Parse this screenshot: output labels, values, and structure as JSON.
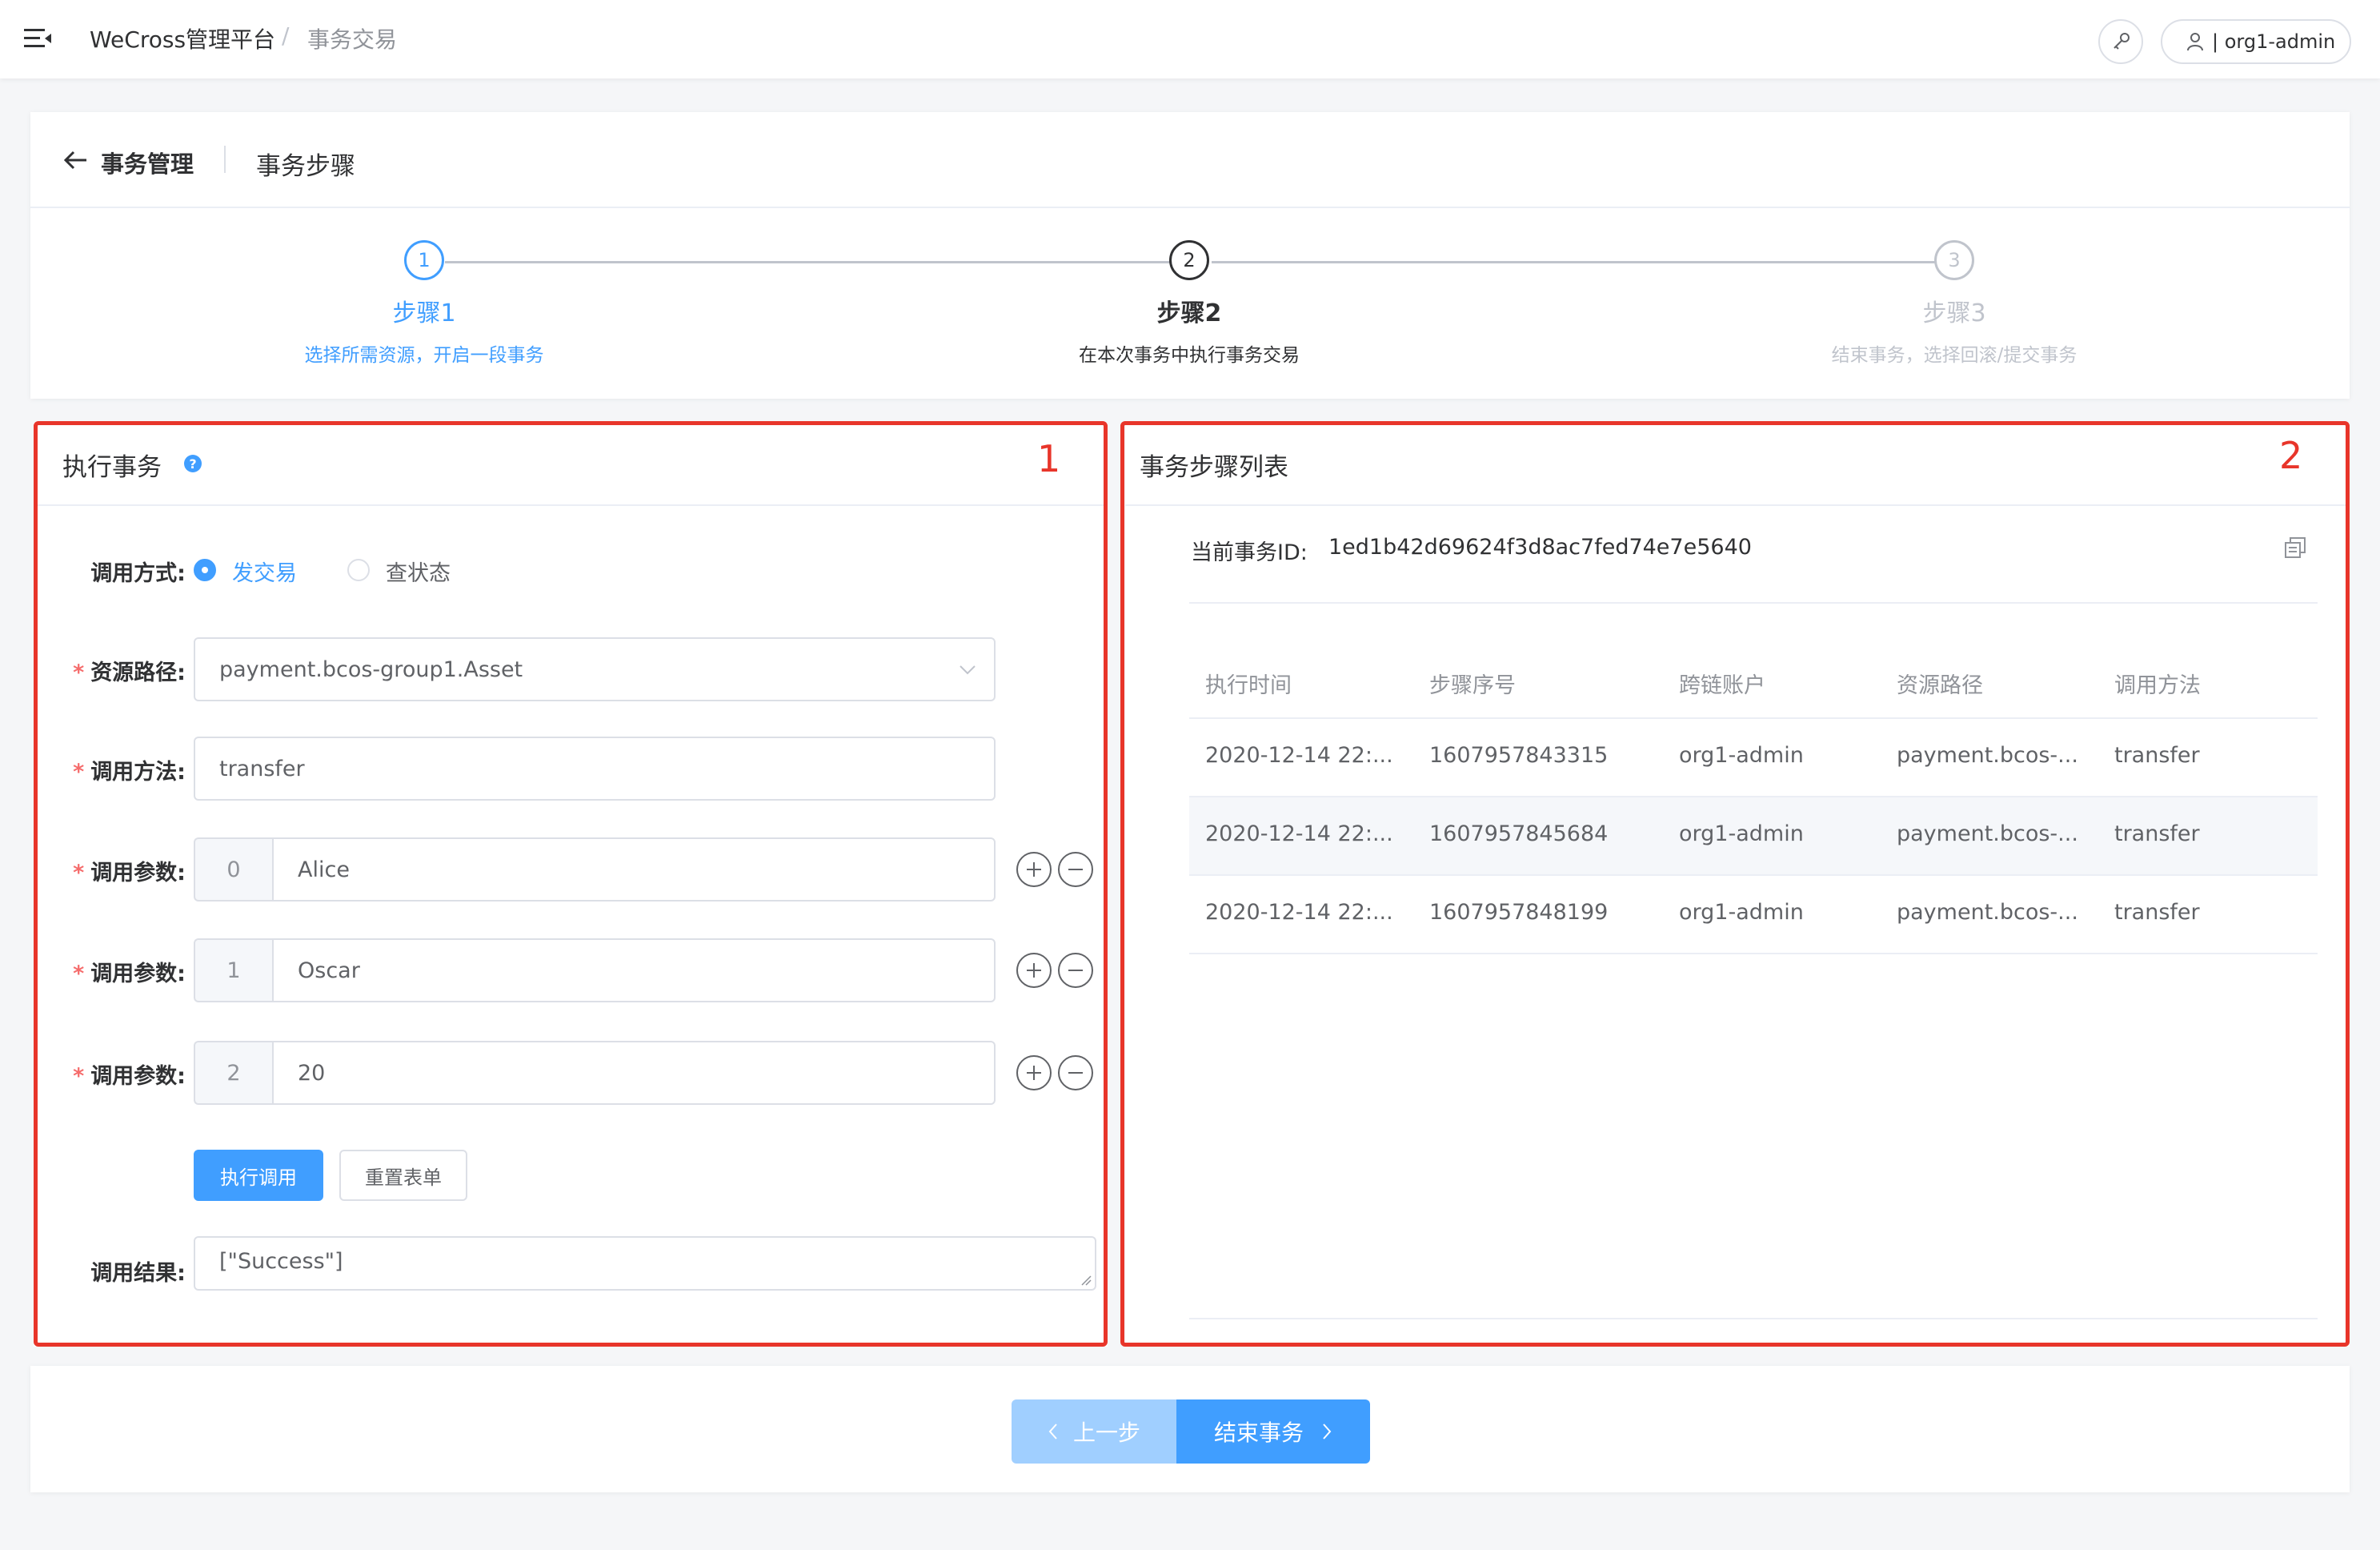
{
  "topbar": {
    "brand": "WeCross管理平台",
    "separator": "/",
    "breadcrumb": "事务交易",
    "user_label": "| org1-admin"
  },
  "header": {
    "back_label": "事务管理",
    "title": "事务步骤"
  },
  "steps": [
    {
      "number": "1",
      "title": "步骤1",
      "desc": "选择所需资源，开启一段事务",
      "status": "done"
    },
    {
      "number": "2",
      "title": "步骤2",
      "desc": "在本次事务中执行事务交易",
      "status": "current"
    },
    {
      "number": "3",
      "title": "步骤3",
      "desc": "结束事务，选择回滚/提交事务",
      "status": "wait"
    }
  ],
  "exec_panel": {
    "title": "执行事务",
    "help_glyph": "?",
    "box_number": "1",
    "invoke_mode_label": "调用方式:",
    "mode_send": "发交易",
    "mode_query": "查状态",
    "resource_label": "资源路径:",
    "resource_value": "payment.bcos-group1.Asset",
    "method_label": "调用方法:",
    "method_value": "transfer",
    "param_label": "调用参数:",
    "params": [
      {
        "index": "0",
        "value": "Alice"
      },
      {
        "index": "1",
        "value": "Oscar"
      },
      {
        "index": "2",
        "value": "20"
      }
    ],
    "required_mark": "*",
    "execute_button": "执行调用",
    "reset_button": "重置表单",
    "result_label": "调用结果:",
    "result_value": "[\"Success\"]"
  },
  "steps_panel": {
    "title": "事务步骤列表",
    "box_number": "2",
    "txid_label": "当前事务ID:",
    "txid_value": "1ed1b42d69624f3d8ac7fed74e7e5640",
    "columns": [
      "执行时间",
      "步骤序号",
      "跨链账户",
      "资源路径",
      "调用方法"
    ],
    "rows": [
      [
        "2020-12-14 22:...",
        "1607957843315",
        "org1-admin",
        "payment.bcos-...",
        "transfer"
      ],
      [
        "2020-12-14 22:...",
        "1607957845684",
        "org1-admin",
        "payment.bcos-...",
        "transfer"
      ],
      [
        "2020-12-14 22:...",
        "1607957848199",
        "org1-admin",
        "payment.bcos-...",
        "transfer"
      ]
    ]
  },
  "footer": {
    "prev_label": "上一步",
    "next_label": "结束事务"
  },
  "colors": {
    "primary": "#409eff",
    "primary_light": "#a0cfff",
    "annotation_red": "#e8352a",
    "required_red": "#f56c6c"
  }
}
